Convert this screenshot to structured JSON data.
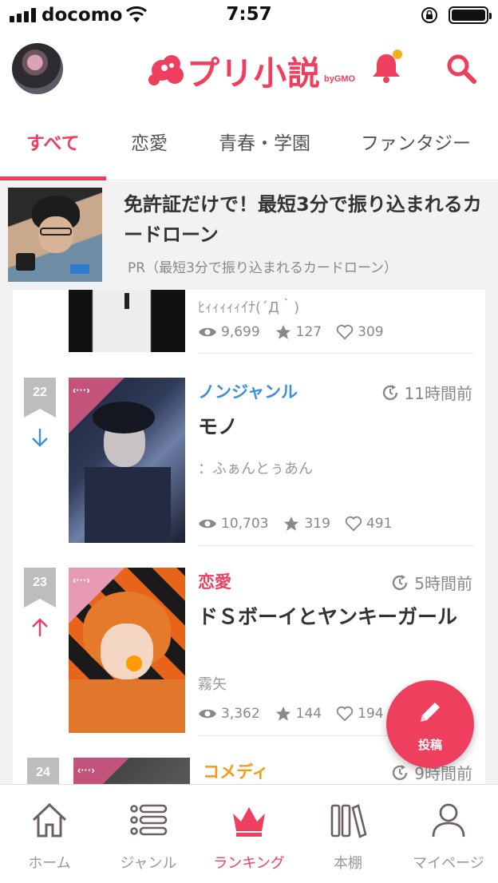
{
  "status_bar": {
    "carrier": "docomo",
    "time": "7:57"
  },
  "header": {
    "logo_text": "プリ小説",
    "logo_by": "byGMO"
  },
  "colors": {
    "brand": "#ef3f5e",
    "notification_dot": "#f2b01e",
    "genre_nongenre": "#3f8fd8",
    "genre_romance": "#ef3f5e",
    "genre_comedy": "#f59a1b",
    "trend_down": "#3f8fd8",
    "trend_up": "#ef3f5e"
  },
  "tabs": [
    {
      "label": "すべて",
      "active": true
    },
    {
      "label": "恋愛",
      "active": false
    },
    {
      "label": "青春・学園",
      "active": false
    },
    {
      "label": "ファンタジー",
      "active": false
    }
  ],
  "ad": {
    "title": "免許証だけで！最短3分で振り込まれるカードローン",
    "pr": "PR（最短3分で振り込まれるカードローン）"
  },
  "partial_item": {
    "author": "ﾋｨｨｨｨｨｲﾅ(´Д｀)",
    "views": "9,699",
    "stars": "127",
    "likes": "309"
  },
  "items": [
    {
      "rank": "22",
      "trend": "down",
      "trend_icon": "arrow-down-icon",
      "genre": "ノンジャンル",
      "ago": "11時間前",
      "title": "モノ",
      "author": "：ふぁんとぅあん",
      "views": "10,703",
      "stars": "319",
      "likes": "491"
    },
    {
      "rank": "23",
      "trend": "up",
      "trend_icon": "arrow-up-icon",
      "genre": "恋愛",
      "ago": "5時間前",
      "title": "ドＳボーイとヤンキーガール",
      "author": "霧矢",
      "views": "3,362",
      "stars": "144",
      "likes": "194"
    },
    {
      "rank": "24",
      "genre": "コメディ",
      "ago": "9時間前"
    }
  ],
  "fab": {
    "label": "投稿"
  },
  "bottom_nav": [
    {
      "label": "ホーム",
      "icon": "home-icon",
      "active": false
    },
    {
      "label": "ジャンル",
      "icon": "list-icon",
      "active": false
    },
    {
      "label": "ランキング",
      "icon": "crown-icon",
      "active": true
    },
    {
      "label": "本棚",
      "icon": "bookshelf-icon",
      "active": false
    },
    {
      "label": "マイページ",
      "icon": "person-icon",
      "active": false
    }
  ]
}
